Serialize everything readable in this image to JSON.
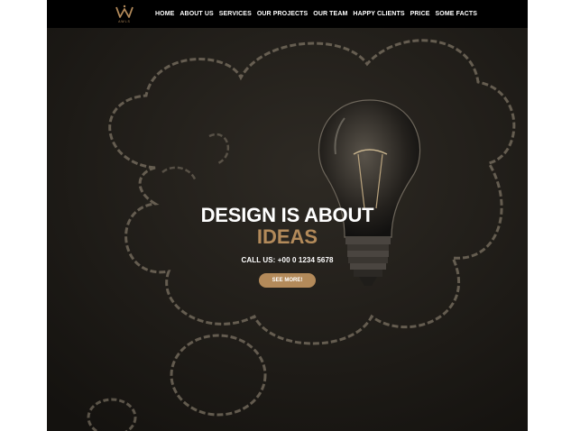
{
  "logo": {
    "icon": "w-crown-logo-icon",
    "wordmark": "AWLS"
  },
  "nav": {
    "items": [
      "HOME",
      "ABOUT US",
      "SERVICES",
      "OUR PROJECTS",
      "OUR TEAM",
      "HAPPY CLIENTS",
      "PRICE",
      "SOME FACTS"
    ]
  },
  "hero": {
    "title_line1": "DESIGN IS ABOUT",
    "title_line2": "IDEAS",
    "phone": "CALL US: +00 0 1234 5678",
    "button": "SEE MORE!"
  },
  "colors": {
    "accent": "#b38a5a",
    "background": "#1b1916",
    "navbar": "#000000"
  }
}
